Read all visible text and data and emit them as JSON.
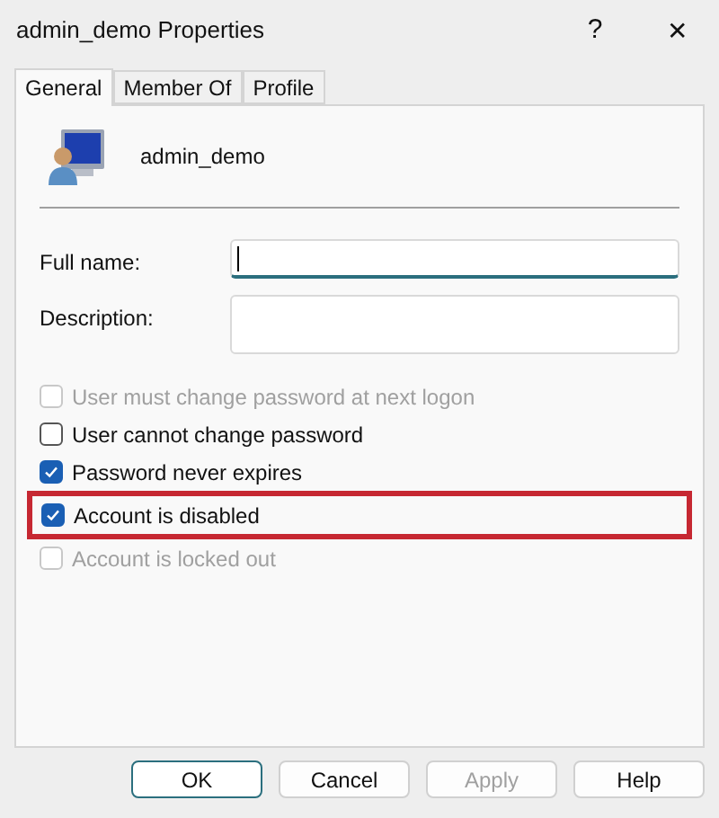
{
  "window": {
    "title": "admin_demo Properties",
    "help": "?",
    "close": "✕"
  },
  "tabs": [
    {
      "label": "General",
      "selected": true
    },
    {
      "label": "Member Of",
      "selected": false
    },
    {
      "label": "Profile",
      "selected": false
    }
  ],
  "user": {
    "name": "admin_demo"
  },
  "fields": [
    {
      "label": "Full name:",
      "focused": true
    },
    {
      "label": "Description:",
      "focused": false
    }
  ],
  "options": [
    {
      "label": "User must change password at next logon",
      "checked": false,
      "disabled": true,
      "highlighted": false
    },
    {
      "label": "User cannot change password",
      "checked": false,
      "disabled": false,
      "highlighted": false
    },
    {
      "label": "Password never expires",
      "checked": true,
      "disabled": false,
      "highlighted": false
    },
    {
      "label": "Account is disabled",
      "checked": true,
      "disabled": false,
      "highlighted": true
    },
    {
      "label": "Account is locked out",
      "checked": false,
      "disabled": true,
      "highlighted": false
    }
  ],
  "buttons": [
    {
      "label": "OK",
      "default": true,
      "disabled": false
    },
    {
      "label": "Cancel",
      "default": false,
      "disabled": false
    },
    {
      "label": "Apply",
      "default": false,
      "disabled": true
    },
    {
      "label": "Help",
      "default": false,
      "disabled": false
    }
  ]
}
